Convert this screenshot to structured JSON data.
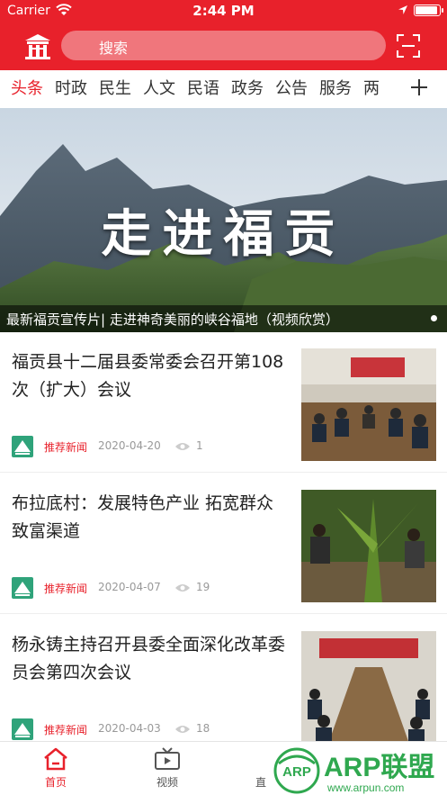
{
  "status_bar": {
    "carrier": "Carrier",
    "time": "2:44 PM",
    "battery_level": 1.0
  },
  "header": {
    "logo_icon": "building-icon",
    "search_placeholder": "搜索",
    "scan_icon": "scan-icon"
  },
  "tabs": {
    "items": [
      "头条",
      "时政",
      "民生",
      "人文",
      "民语",
      "政务",
      "公告",
      "服务",
      "两"
    ],
    "active_index": 0,
    "add_icon": "plus-icon"
  },
  "banner": {
    "title": "走进福贡",
    "caption": "最新福贡宣传片| 走进神奇美丽的峡谷福地（视频欣赏）"
  },
  "news": [
    {
      "title": "福贡县十二届县委常委会召开第108次（扩大）会议",
      "tag": "推荐新闻",
      "date": "2020-04-20",
      "views": "1",
      "thumb": "meeting-photo"
    },
    {
      "title": "布拉底村：发展特色产业 拓宽群众致富渠道",
      "tag": "推荐新闻",
      "date": "2020-04-07",
      "views": "19",
      "thumb": "farming-photo"
    },
    {
      "title": "杨永铸主持召开县委全面深化改革委员会第四次会议",
      "tag": "推荐新闻",
      "date": "2020-04-03",
      "views": "18",
      "thumb": "conference-photo"
    }
  ],
  "tabbar": {
    "items": [
      {
        "label": "首页",
        "icon": "home-icon",
        "active": true
      },
      {
        "label": "视频",
        "icon": "tv-icon",
        "active": false
      },
      {
        "label": "直",
        "icon": "",
        "active": false
      }
    ]
  },
  "watermark": {
    "text": "ARP联盟",
    "url": "www.arpun.com",
    "badge": "ARP"
  },
  "colors": {
    "brand_red": "#e8212b",
    "watermark_green": "#2fa84f"
  }
}
